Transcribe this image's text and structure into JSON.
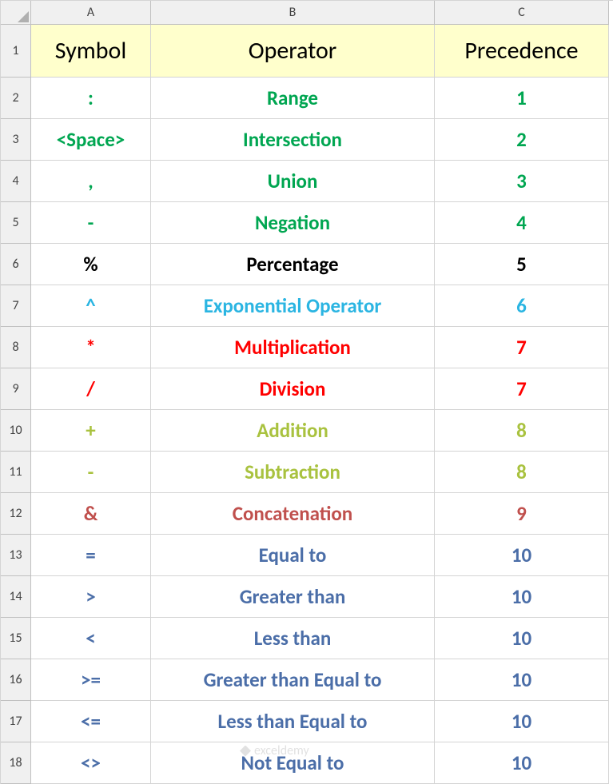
{
  "columns": [
    "A",
    "B",
    "C"
  ],
  "rowNumbers": [
    "1",
    "2",
    "3",
    "4",
    "5",
    "6",
    "7",
    "8",
    "9",
    "10",
    "11",
    "12",
    "13",
    "14",
    "15",
    "16",
    "17",
    "18"
  ],
  "header": {
    "symbol": "Symbol",
    "operator": "Operator",
    "precedence": "Precedence"
  },
  "rows": [
    {
      "symbol": ":",
      "operator": "Range",
      "precedence": "1",
      "colorClass": "c-green"
    },
    {
      "symbol": "<Space>",
      "operator": "Intersection",
      "precedence": "2",
      "colorClass": "c-green"
    },
    {
      "symbol": ",",
      "operator": "Union",
      "precedence": "3",
      "colorClass": "c-green"
    },
    {
      "symbol": "-",
      "operator": "Negation",
      "precedence": "4",
      "colorClass": "c-green"
    },
    {
      "symbol": "%",
      "operator": "Percentage",
      "precedence": "5",
      "colorClass": "c-black"
    },
    {
      "symbol": "^",
      "operator": "Exponential Operator",
      "precedence": "6",
      "colorClass": "c-sky"
    },
    {
      "symbol": "*",
      "operator": "Multiplication",
      "precedence": "7",
      "colorClass": "c-red"
    },
    {
      "symbol": "/",
      "operator": "Division",
      "precedence": "7",
      "colorClass": "c-red"
    },
    {
      "symbol": "+",
      "operator": "Addition",
      "precedence": "8",
      "colorClass": "c-olive"
    },
    {
      "symbol": "-",
      "operator": "Subtraction",
      "precedence": "8",
      "colorClass": "c-olive"
    },
    {
      "symbol": "&",
      "operator": "Concatenation",
      "precedence": "9",
      "colorClass": "c-brick"
    },
    {
      "symbol": "=",
      "operator": "Equal to",
      "precedence": "10",
      "colorClass": "c-slate"
    },
    {
      "symbol": ">",
      "operator": "Greater than",
      "precedence": "10",
      "colorClass": "c-slate"
    },
    {
      "symbol": "<",
      "operator": "Less than",
      "precedence": "10",
      "colorClass": "c-slate"
    },
    {
      "symbol": ">=",
      "operator": "Greater than Equal to",
      "precedence": "10",
      "colorClass": "c-slate"
    },
    {
      "symbol": "<=",
      "operator": "Less than Equal to",
      "precedence": "10",
      "colorClass": "c-slate"
    },
    {
      "symbol": "<>",
      "operator": "Not Equal to",
      "precedence": "10",
      "colorClass": "c-slate"
    }
  ],
  "chart_data": {
    "type": "table",
    "title": "Excel Operator Precedence",
    "columns": [
      "Symbol",
      "Operator",
      "Precedence"
    ],
    "data": [
      [
        ":",
        "Range",
        1
      ],
      [
        "<Space>",
        "Intersection",
        2
      ],
      [
        ",",
        "Union",
        3
      ],
      [
        "-",
        "Negation",
        4
      ],
      [
        "%",
        "Percentage",
        5
      ],
      [
        "^",
        "Exponential Operator",
        6
      ],
      [
        "*",
        "Multiplication",
        7
      ],
      [
        "/",
        "Division",
        7
      ],
      [
        "+",
        "Addition",
        8
      ],
      [
        "-",
        "Subtraction",
        8
      ],
      [
        "&",
        "Concatenation",
        9
      ],
      [
        "=",
        "Equal to",
        10
      ],
      [
        ">",
        "Greater than",
        10
      ],
      [
        "<",
        "Less than",
        10
      ],
      [
        ">=",
        "Greater than Equal to",
        10
      ],
      [
        "<=",
        "Less than Equal to",
        10
      ],
      [
        "<>",
        "Not Equal to",
        10
      ]
    ]
  },
  "watermark": "exceldemy"
}
